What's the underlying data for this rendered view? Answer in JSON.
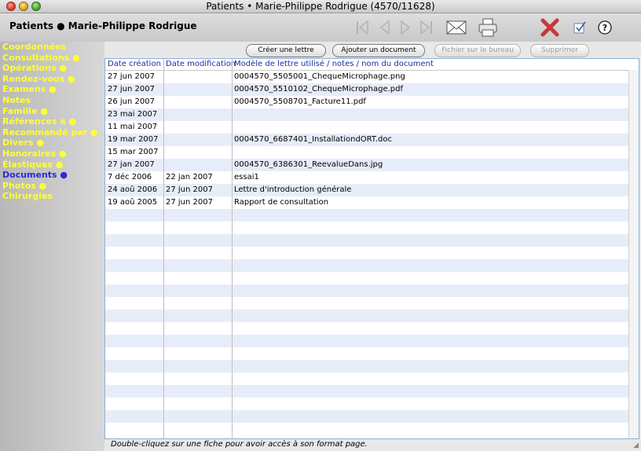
{
  "window": {
    "title": "Patients • Marie-Philippe Rodrigue (4570/11628)"
  },
  "header": {
    "patient": "Patients ● Marie-Philippe Rodrigue"
  },
  "toolbar_icons": [
    "first-record-icon",
    "previous-record-icon",
    "next-record-icon",
    "last-record-icon",
    "envelope-icon",
    "printer-icon",
    "delete-x-icon",
    "checkbox-icon",
    "help-icon"
  ],
  "sidebar": {
    "items": [
      {
        "label": "Coordonnées"
      },
      {
        "label": "Consultations ●"
      },
      {
        "label": "Opérations ●"
      },
      {
        "label": "Rendez-vous ●"
      },
      {
        "label": "Examens ●"
      },
      {
        "label": "Notes"
      },
      {
        "label": "Famille ●"
      },
      {
        "label": "Références à ●"
      },
      {
        "label": "Recommandé par ●"
      },
      {
        "label": "Divers ●"
      },
      {
        "label": "Honoraires ●"
      },
      {
        "label": "Élastiques ●"
      },
      {
        "label": "Documents ●"
      },
      {
        "label": "Photos ●"
      },
      {
        "label": "Chirurgies"
      }
    ],
    "active_index": 12,
    "text_color": "#ffff33",
    "active_color": "#2b2bd6"
  },
  "buttons": {
    "create_letter": "Créer une lettre",
    "add_document": "Ajouter un document",
    "desktop_file": "Fichier sur le bureau",
    "delete": "Supprimer"
  },
  "table": {
    "columns": [
      "Date création",
      "Date modification",
      "Modèle de lettre utilisé / notes / nom du document"
    ],
    "rows": [
      [
        "27 jun 2007",
        "",
        "0004570_5505001_ChequeMicrophage.png"
      ],
      [
        "27 jun 2007",
        "",
        "0004570_5510102_ChequeMicrophage.pdf"
      ],
      [
        "26 jun 2007",
        "",
        "0004570_5508701_Facture11.pdf"
      ],
      [
        "23 mai 2007",
        "",
        ""
      ],
      [
        "11 mai 2007",
        "",
        ""
      ],
      [
        "19 mar 2007",
        "",
        "0004570_6687401_InstallationdORT.doc"
      ],
      [
        "15 mar 2007",
        "",
        ""
      ],
      [
        "27 jan 2007",
        "",
        "0004570_6386301_ReevalueDans.jpg"
      ],
      [
        "7 déc 2006",
        "22 jan 2007",
        "essai1"
      ],
      [
        "24 aoû 2006",
        "27 jun 2007",
        "Lettre d'introduction générale"
      ],
      [
        "19 aoû 2005",
        "27 jun 2007",
        "Rapport de consultation"
      ]
    ],
    "total_visible_rows": 29
  },
  "footer": {
    "hint": "Double-cliquez sur une fiche pour avoir accès à son format page."
  }
}
